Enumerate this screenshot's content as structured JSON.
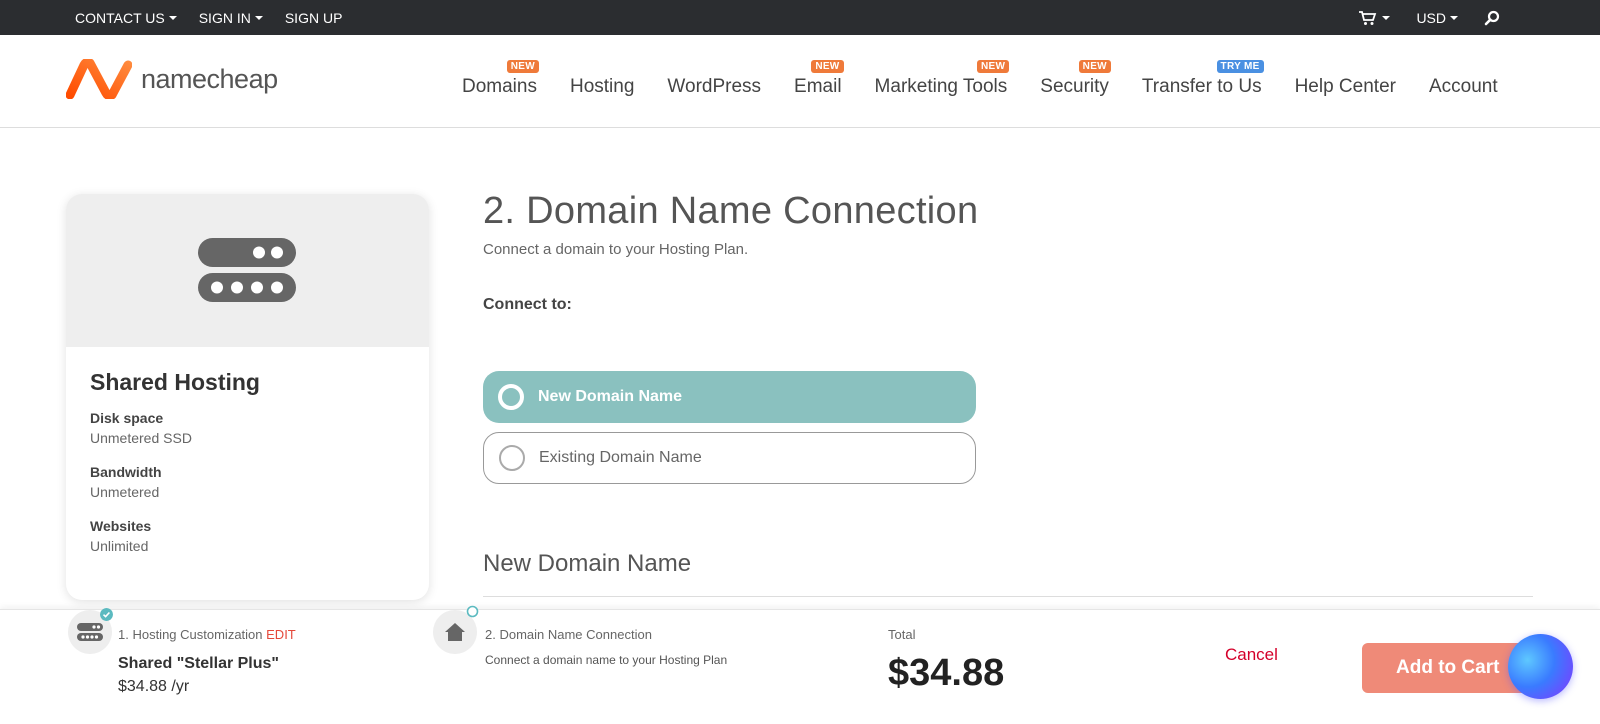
{
  "topbar": {
    "contact": "CONTACT US",
    "signin": "SIGN IN",
    "signup": "SIGN UP",
    "currency": "USD"
  },
  "brand": {
    "name": "namecheap",
    "accent": "#f15a22"
  },
  "nav": {
    "items": [
      {
        "label": "Domains",
        "badge": "NEW"
      },
      {
        "label": "Hosting",
        "badge": ""
      },
      {
        "label": "WordPress",
        "badge": ""
      },
      {
        "label": "Email",
        "badge": "NEW"
      },
      {
        "label": "Marketing Tools",
        "badge": "NEW"
      },
      {
        "label": "Security",
        "badge": "NEW"
      },
      {
        "label": "Transfer to Us",
        "badge": "TRY ME"
      },
      {
        "label": "Help Center",
        "badge": ""
      },
      {
        "label": "Account",
        "badge": ""
      }
    ]
  },
  "card": {
    "title": "Shared Hosting",
    "specs": [
      {
        "label": "Disk space",
        "value": "Unmetered SSD"
      },
      {
        "label": "Bandwidth",
        "value": "Unmetered"
      },
      {
        "label": "Websites",
        "value": "Unlimited"
      }
    ]
  },
  "main": {
    "title": "2. Domain Name Connection",
    "subtitle": "Connect a domain to your Hosting Plan.",
    "connect_label": "Connect to:",
    "option_new": "New Domain Name",
    "option_existing": "Existing Domain Name",
    "section_title": "New Domain Name",
    "selected_color": "#8ac1bf"
  },
  "bottom": {
    "step1_label": "1. Hosting Customization",
    "step1_edit": "EDIT",
    "plan_name": "Shared \"Stellar Plus\"",
    "plan_price": "$34.88 /yr",
    "step2_label": "2. Domain Name Connection",
    "step2_desc": "Connect a domain name to your Hosting Plan",
    "total_label": "Total",
    "total_value": "$34.88",
    "cancel": "Cancel",
    "add_to_cart": "Add to Cart",
    "add_to_cart_color": "#ef8a78"
  }
}
